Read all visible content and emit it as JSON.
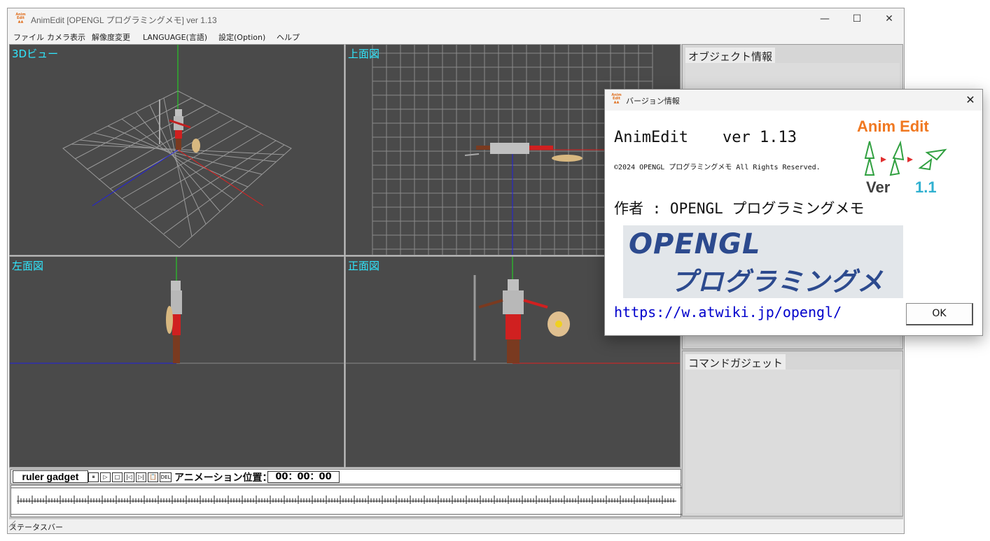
{
  "window": {
    "title": "AnimEdit [OPENGL プログラミングメモ] ver 1.13",
    "icon": "animedit-app-icon"
  },
  "menu": [
    "ファイル",
    "カメラ表示",
    "解像度変更",
    "LANGUAGE(言語)",
    "設定(Option)",
    "ヘルプ"
  ],
  "viewports": {
    "v3d": "3Dビュー",
    "top": "上面図",
    "left": "左面図",
    "front": "正面図"
  },
  "panels": {
    "object_info": "オブジェクト情報",
    "command_gadget": "コマンドガジェット"
  },
  "ruler": {
    "title": "ruler gadget",
    "controls": [
      "pause-icon",
      "play-icon",
      "stop-icon",
      "skip-start-icon",
      "skip-end-icon",
      "clipboard-icon",
      "delete-icon"
    ],
    "control_glyphs": [
      "⏸",
      "▷",
      "□",
      "|◁",
      "▷|",
      "📋",
      "DEL"
    ],
    "anim_label": "アニメーション位置：",
    "anim_time": "00：00：00"
  },
  "status": {
    "text": "ステータスバー"
  },
  "dialog": {
    "title": "バージョン情報",
    "app_name": "AnimEdit",
    "version": "ver 1.13",
    "copyright": "©2024 OPENGL プログラミングメモ All Rights Reserved.",
    "author": "作者 : OPENGL プログラミングメモ",
    "banner_line1": "OPENGL",
    "banner_line2": "プログラミングメモ",
    "link": "https://w.atwiki.jp/opengl/",
    "ok": "OK",
    "logo": {
      "title": "Anim Edit",
      "ver_label": "Ver",
      "ver_num": "1.1"
    }
  },
  "colors": {
    "viewport_bg": "#4a4a4a",
    "viewport_label": "#30e8ff",
    "axis_x": "#e02020",
    "axis_y": "#20e020",
    "axis_z": "#2020e0",
    "link": "#0000cc",
    "logo_orange": "#f07820"
  }
}
